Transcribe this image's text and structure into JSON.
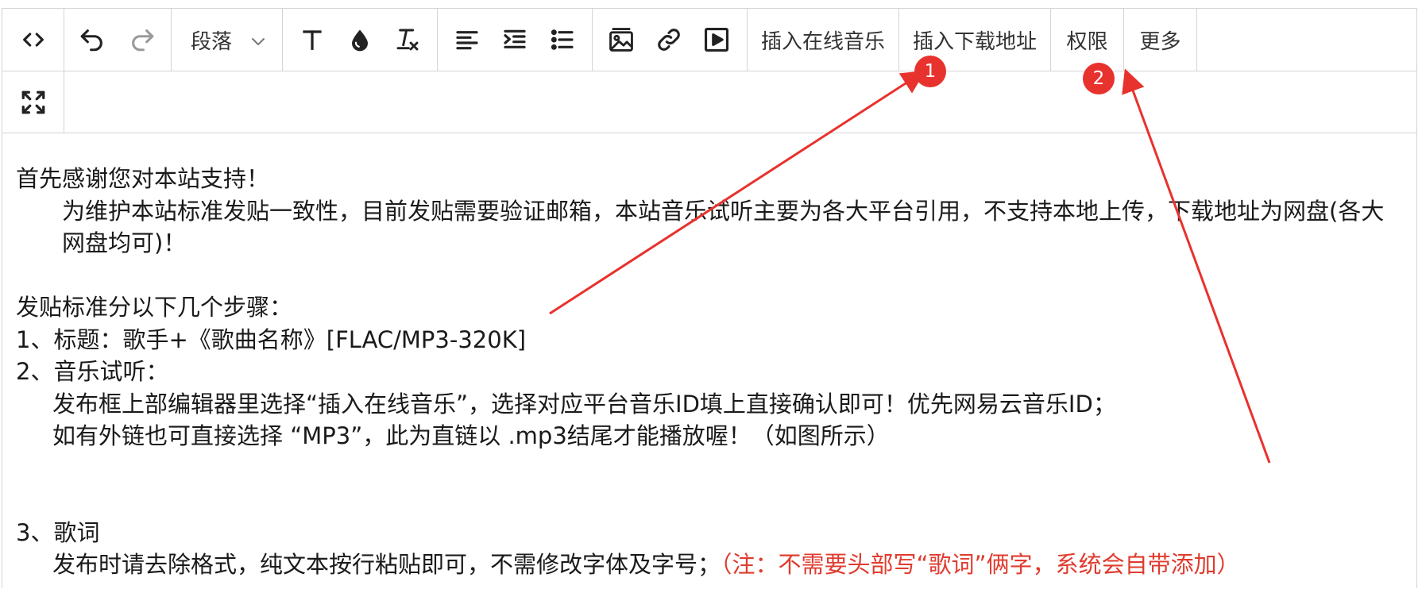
{
  "toolbar": {
    "paragraph_select": "段落",
    "insert_online_music": "插入在线音乐",
    "insert_download_link": "插入下载地址",
    "permissions": "权限",
    "more": "更多"
  },
  "annotations": {
    "badge1": "1",
    "badge2": "2",
    "color": "#e8322d"
  },
  "content": {
    "line1": "首先感谢您对本站支持！",
    "line2": "为维护本站标准发贴一致性，目前发贴需要验证邮箱，本站音乐试听主要为各大平台引用，不支持本地上传，下载地址为网盘(各大网盘均可)！",
    "line3": "发贴标准分以下几个步骤：",
    "line4": "1、标题：歌手+《歌曲名称》[FLAC/MP3-320K]",
    "line5": "2、音乐试听：",
    "line6": "发布框上部编辑器里选择“插入在线音乐”，选择对应平台音乐ID填上直接确认即可！优先网易云音乐ID；",
    "line7": "如有外链也可直接选择 “MP3”，此为直链以 .mp3结尾才能播放喔！（如图所示）",
    "line8": "3、歌词",
    "line9_black": "发布时请去除格式，纯文本按行粘贴即可，不需修改字体及字号；",
    "line9_red": "（注：不需要头部写“歌词”俩字，系统会自带添加）",
    "red_color": "#e03c2f"
  }
}
